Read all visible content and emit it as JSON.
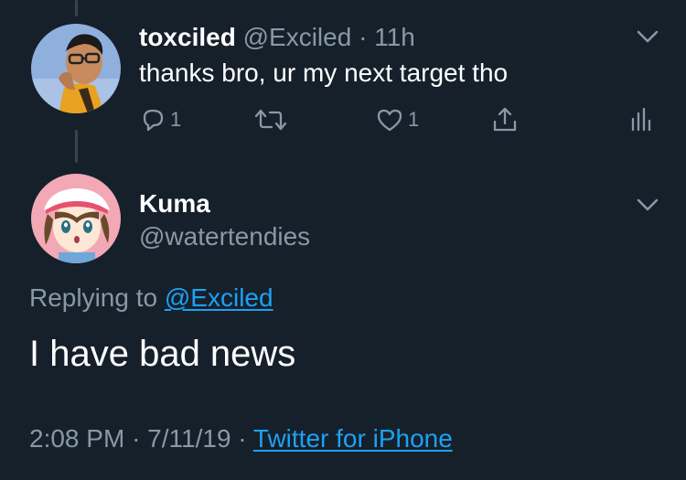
{
  "tweet1": {
    "display_name": "toxciled",
    "handle": "@Exciled",
    "separator": "·",
    "time": "11h",
    "text": "thanks bro, ur my next target tho",
    "reply_count": "1",
    "like_count": "1",
    "avatar_icon": "user-avatar-photo",
    "menu_icon": "chevron-down-icon"
  },
  "tweet2": {
    "display_name": "Kuma",
    "handle": "@watertendies",
    "replying_prefix": "Replying to",
    "replying_to": "@Exciled",
    "text": "I have bad news",
    "time": "2:08 PM",
    "sep1": "·",
    "date": "7/11/19",
    "sep2": "·",
    "source": "Twitter for iPhone",
    "avatar_icon": "anime-avatar",
    "menu_icon": "chevron-down-icon"
  },
  "colors": {
    "background": "#15202b",
    "muted": "#8899a6",
    "link": "#1da1f2",
    "text": "#ffffff"
  }
}
